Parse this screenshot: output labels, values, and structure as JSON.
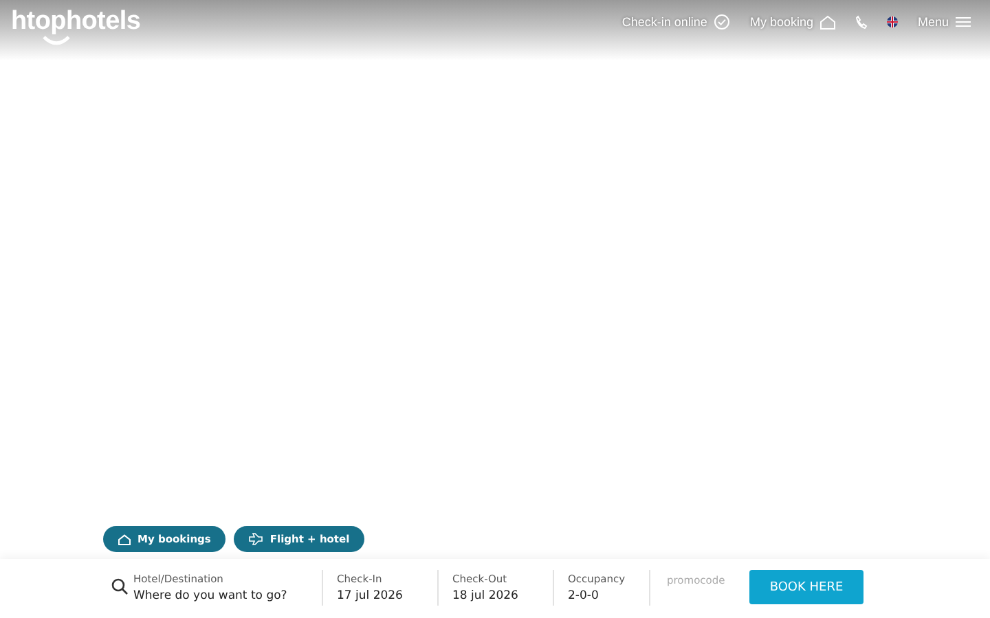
{
  "header": {
    "logo": "htophotels",
    "nav": [
      {
        "kind": "checkin",
        "label": "Check-in online"
      },
      {
        "kind": "booking",
        "label": "My booking"
      },
      {
        "kind": "phone"
      },
      {
        "kind": "flag"
      },
      {
        "kind": "menu",
        "label": "Menu"
      }
    ]
  },
  "quick_buttons": [
    {
      "kind": "home",
      "label": "My bookings"
    },
    {
      "kind": "plane",
      "label": "Flight + hotel"
    }
  ],
  "search": {
    "fields": [
      {
        "kind": "search",
        "label": "Hotel/Destination",
        "placeholder": "Where do you want to go?"
      },
      {
        "kind": "value",
        "label": "Check-In",
        "value": "17 jul 2026"
      },
      {
        "kind": "value",
        "label": "Check-Out",
        "value": "18 jul 2026"
      },
      {
        "kind": "value",
        "label": "Occupancy",
        "value": "2-0-0"
      }
    ],
    "promocode": {
      "placeholder": "promocode"
    },
    "submit": "BOOK HERE"
  }
}
